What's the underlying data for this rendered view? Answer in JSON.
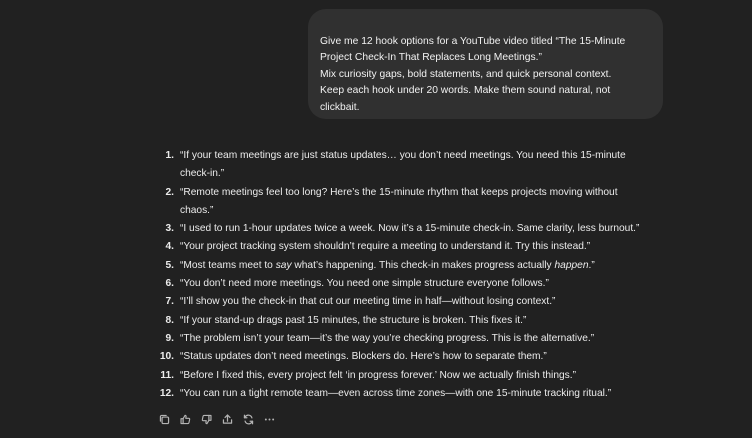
{
  "conversation": {
    "user_message": {
      "lines": [
        "Give me 12 hook options for a YouTube video titled “The 15-Minute",
        "Project Check-In That Replaces Long Meetings.”",
        "Mix curiosity gaps, bold statements, and quick personal context.",
        "Keep each hook under 20 words. Make them sound natural, not",
        "clickbait."
      ]
    },
    "assistant_response": {
      "items": [
        {
          "number": "1.",
          "line_1": "“If your team meetings are just status updates… you don’t need meetings. You need this 15-minute",
          "line_2": "check-in.”"
        },
        {
          "number": "2.",
          "line_1": "“Remote meetings feel too long? Here’s the 15-minute rhythm that keeps projects moving without",
          "line_2": "chaos.”"
        },
        {
          "number": "3.",
          "text": "“I used to run 1-hour updates twice a week. Now it’s a 15-minute check-in. Same clarity, less burnout.”"
        },
        {
          "number": "4.",
          "text": "“Your project tracking system shouldn’t require a meeting to understand it. Try this instead.”"
        },
        {
          "number": "5.",
          "part_1": "“Most teams meet to ",
          "emphasis_1": "say",
          "part_2": " what’s happening. This check-in makes progress actually ",
          "emphasis_2": "happen",
          "part_3": ".”"
        },
        {
          "number": "6.",
          "text": "“You don’t need more meetings. You need one simple structure everyone follows.”"
        },
        {
          "number": "7.",
          "text": "“I’ll show you the check-in that cut our meeting time in half—without losing context.”"
        },
        {
          "number": "8.",
          "text": "“If your stand-up drags past 15 minutes, the structure is broken. This fixes it.”"
        },
        {
          "number": "9.",
          "text": "“The problem isn’t your team—it’s the way you’re checking progress. This is the alternative.”"
        },
        {
          "number": "10.",
          "text": "“Status updates don’t need meetings. Blockers do. Here’s how to separate them.”"
        },
        {
          "number": "11.",
          "text": "“Before I fixed this, every project felt ‘in progress forever.’ Now we actually finish things.”"
        },
        {
          "number": "12.",
          "text": "“You can run a tight remote team—even across time zones—with one 15-minute tracking ritual.”"
        }
      ]
    },
    "response_actions": [
      {
        "icon": "copy-icon"
      },
      {
        "icon": "thumbs-up-icon"
      },
      {
        "icon": "thumbs-down-icon"
      },
      {
        "icon": "share-icon"
      },
      {
        "icon": "regenerate-icon"
      },
      {
        "icon": "more-options-icon"
      }
    ]
  },
  "colors": {
    "background": "#212121",
    "user_bubble": "#303030",
    "text_primary": "#ececec",
    "icon": "#b4b4b4"
  }
}
